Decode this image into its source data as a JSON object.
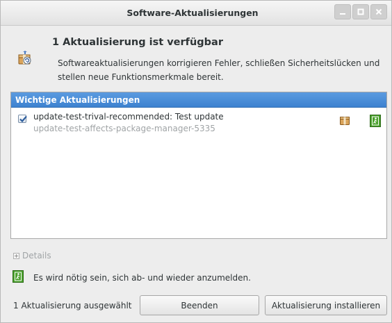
{
  "window": {
    "title": "Software-Aktualisierungen",
    "controls": [
      "minimize",
      "maximize",
      "close"
    ]
  },
  "header": {
    "headline": "1 Aktualisierung ist verfügbar",
    "description": "Softwareaktualisierungen korrigieren Fehler, schließen Sicherheitslücken und stellen neue Funktionsmerkmale bereit.",
    "icon": "package-update-icon"
  },
  "list": {
    "section_header": "Wichtige Aktualisierungen",
    "items": [
      {
        "checked": true,
        "title": "update-test-trival-recommended: Test update",
        "package": "update-test-affects-package-manager-5335",
        "icons": [
          "package-icon",
          "logout-required-icon"
        ]
      }
    ]
  },
  "details": {
    "label": "Details",
    "expanded": false
  },
  "notice": {
    "text": "Es wird nötig sein, sich ab- und wieder anzumelden.",
    "icon": "logout-required-icon"
  },
  "footer": {
    "status": "1 Aktualisierung ausgewählt",
    "close_label": "Beenden",
    "install_label": "Aktualisierung installieren"
  },
  "colors": {
    "selection_header": "#4a8ad8",
    "logout_icon": "#4aa02c"
  }
}
